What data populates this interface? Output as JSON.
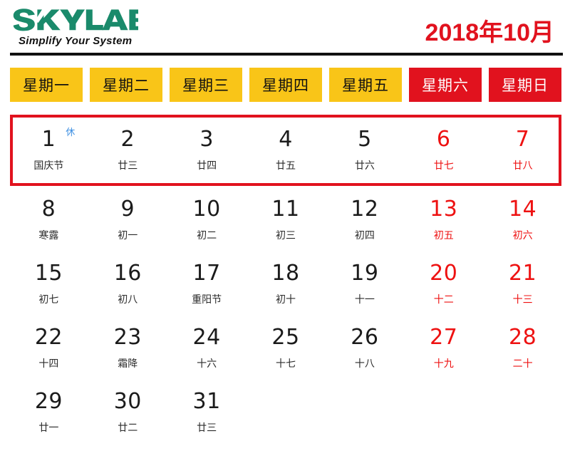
{
  "brand": {
    "name": "SKYLAB",
    "tagline": "Simplify Your System",
    "logo_color": "#1a8a6b"
  },
  "header": {
    "month_title": "2018年10月",
    "title_color": "#e1121e"
  },
  "colors": {
    "weekday_bg": "#f9c518",
    "weekend_bg": "#e1121e",
    "weekend_text": "#ee1111",
    "rest_badge": "#3f90e2",
    "highlight_border": "#e1121e"
  },
  "weekdays": [
    {
      "label": "星期一",
      "type": "work"
    },
    {
      "label": "星期二",
      "type": "work"
    },
    {
      "label": "星期三",
      "type": "work"
    },
    {
      "label": "星期四",
      "type": "work"
    },
    {
      "label": "星期五",
      "type": "work"
    },
    {
      "label": "星期六",
      "type": "weekend"
    },
    {
      "label": "星期日",
      "type": "weekend"
    }
  ],
  "weeks": [
    {
      "highlight": true,
      "days": [
        {
          "number": "1",
          "lunar": "国庆节",
          "weekend": false,
          "badge": "休"
        },
        {
          "number": "2",
          "lunar": "廿三",
          "weekend": false,
          "badge": ""
        },
        {
          "number": "3",
          "lunar": "廿四",
          "weekend": false,
          "badge": ""
        },
        {
          "number": "4",
          "lunar": "廿五",
          "weekend": false,
          "badge": ""
        },
        {
          "number": "5",
          "lunar": "廿六",
          "weekend": false,
          "badge": ""
        },
        {
          "number": "6",
          "lunar": "廿七",
          "weekend": true,
          "badge": ""
        },
        {
          "number": "7",
          "lunar": "廿八",
          "weekend": true,
          "badge": ""
        }
      ]
    },
    {
      "highlight": false,
      "days": [
        {
          "number": "8",
          "lunar": "寒露",
          "weekend": false,
          "badge": ""
        },
        {
          "number": "9",
          "lunar": "初一",
          "weekend": false,
          "badge": ""
        },
        {
          "number": "10",
          "lunar": "初二",
          "weekend": false,
          "badge": ""
        },
        {
          "number": "11",
          "lunar": "初三",
          "weekend": false,
          "badge": ""
        },
        {
          "number": "12",
          "lunar": "初四",
          "weekend": false,
          "badge": ""
        },
        {
          "number": "13",
          "lunar": "初五",
          "weekend": true,
          "badge": ""
        },
        {
          "number": "14",
          "lunar": "初六",
          "weekend": true,
          "badge": ""
        }
      ]
    },
    {
      "highlight": false,
      "days": [
        {
          "number": "15",
          "lunar": "初七",
          "weekend": false,
          "badge": ""
        },
        {
          "number": "16",
          "lunar": "初八",
          "weekend": false,
          "badge": ""
        },
        {
          "number": "17",
          "lunar": "重阳节",
          "weekend": false,
          "badge": ""
        },
        {
          "number": "18",
          "lunar": "初十",
          "weekend": false,
          "badge": ""
        },
        {
          "number": "19",
          "lunar": "十一",
          "weekend": false,
          "badge": ""
        },
        {
          "number": "20",
          "lunar": "十二",
          "weekend": true,
          "badge": ""
        },
        {
          "number": "21",
          "lunar": "十三",
          "weekend": true,
          "badge": ""
        }
      ]
    },
    {
      "highlight": false,
      "days": [
        {
          "number": "22",
          "lunar": "十四",
          "weekend": false,
          "badge": ""
        },
        {
          "number": "23",
          "lunar": "霜降",
          "weekend": false,
          "badge": ""
        },
        {
          "number": "24",
          "lunar": "十六",
          "weekend": false,
          "badge": ""
        },
        {
          "number": "25",
          "lunar": "十七",
          "weekend": false,
          "badge": ""
        },
        {
          "number": "26",
          "lunar": "十八",
          "weekend": false,
          "badge": ""
        },
        {
          "number": "27",
          "lunar": "十九",
          "weekend": true,
          "badge": ""
        },
        {
          "number": "28",
          "lunar": "二十",
          "weekend": true,
          "badge": ""
        }
      ]
    },
    {
      "highlight": false,
      "days": [
        {
          "number": "29",
          "lunar": "廿一",
          "weekend": false,
          "badge": ""
        },
        {
          "number": "30",
          "lunar": "廿二",
          "weekend": false,
          "badge": ""
        },
        {
          "number": "31",
          "lunar": "廿三",
          "weekend": false,
          "badge": ""
        },
        {
          "number": "",
          "lunar": "",
          "weekend": false,
          "badge": "",
          "empty": true
        },
        {
          "number": "",
          "lunar": "",
          "weekend": false,
          "badge": "",
          "empty": true
        },
        {
          "number": "",
          "lunar": "",
          "weekend": true,
          "badge": "",
          "empty": true
        },
        {
          "number": "",
          "lunar": "",
          "weekend": true,
          "badge": "",
          "empty": true
        }
      ]
    }
  ]
}
